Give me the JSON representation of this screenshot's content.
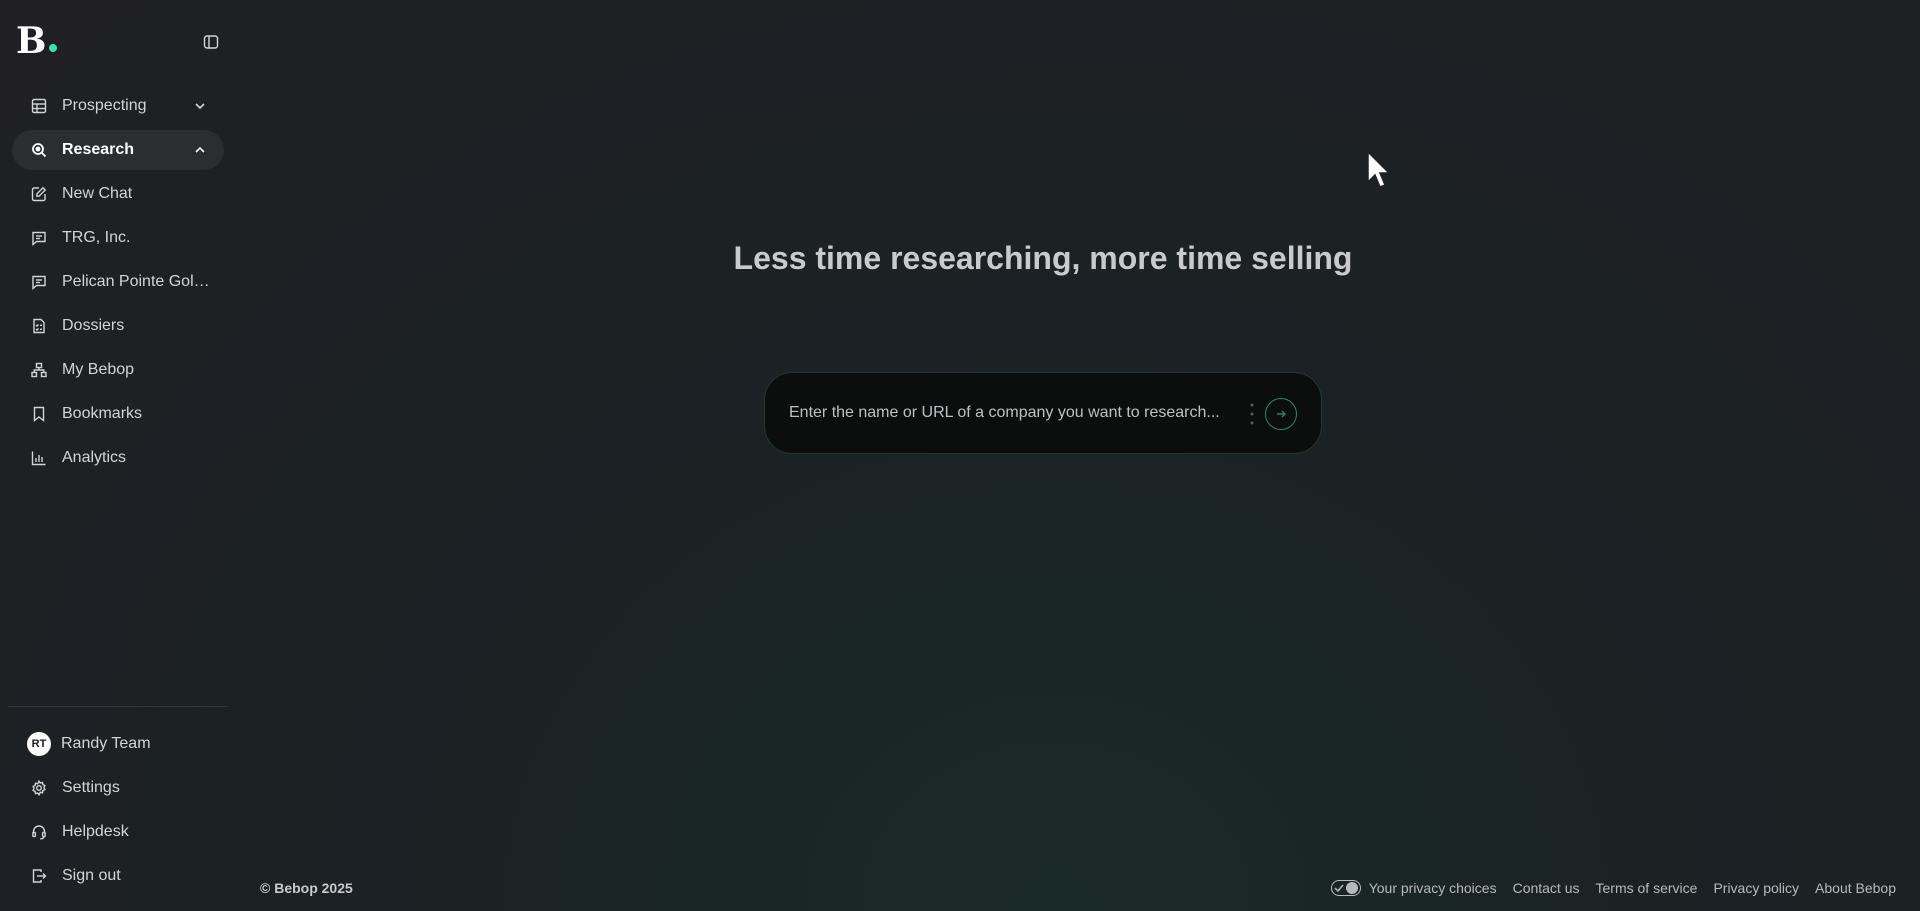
{
  "app": {
    "logo_letter": "B"
  },
  "sidebar": {
    "items": [
      {
        "label": "Prospecting",
        "icon": "table-icon"
      },
      {
        "label": "Research",
        "icon": "search-icon"
      },
      {
        "label": "New Chat",
        "icon": "edit-icon"
      },
      {
        "label": "TRG, Inc.",
        "icon": "chat-icon"
      },
      {
        "label": "Pelican Pointe Golf ...",
        "icon": "chat-icon"
      },
      {
        "label": "Dossiers",
        "icon": "checklist-icon"
      },
      {
        "label": "My Bebop",
        "icon": "hierarchy-icon"
      },
      {
        "label": "Bookmarks",
        "icon": "bookmark-icon"
      },
      {
        "label": "Analytics",
        "icon": "bar-chart-icon"
      }
    ],
    "bottom": [
      {
        "label": "Randy Team",
        "avatar": "RT"
      },
      {
        "label": "Settings",
        "icon": "gear-icon"
      },
      {
        "label": "Helpdesk",
        "icon": "headset-icon"
      },
      {
        "label": "Sign out",
        "icon": "sign-out-icon"
      }
    ]
  },
  "main": {
    "headline": "Less time researching, more time selling",
    "search": {
      "placeholder": "Enter the name or URL of a company you want to research..."
    }
  },
  "footer": {
    "copyright": "© Bebop 2025",
    "privacy": "Your privacy choices",
    "links": [
      "Contact us",
      "Terms of service",
      "Privacy policy",
      "About Bebop"
    ]
  },
  "colors": {
    "accent": "#2ee6a6",
    "button_border": "#1f8f62",
    "active_bg": "#2c2d31"
  }
}
